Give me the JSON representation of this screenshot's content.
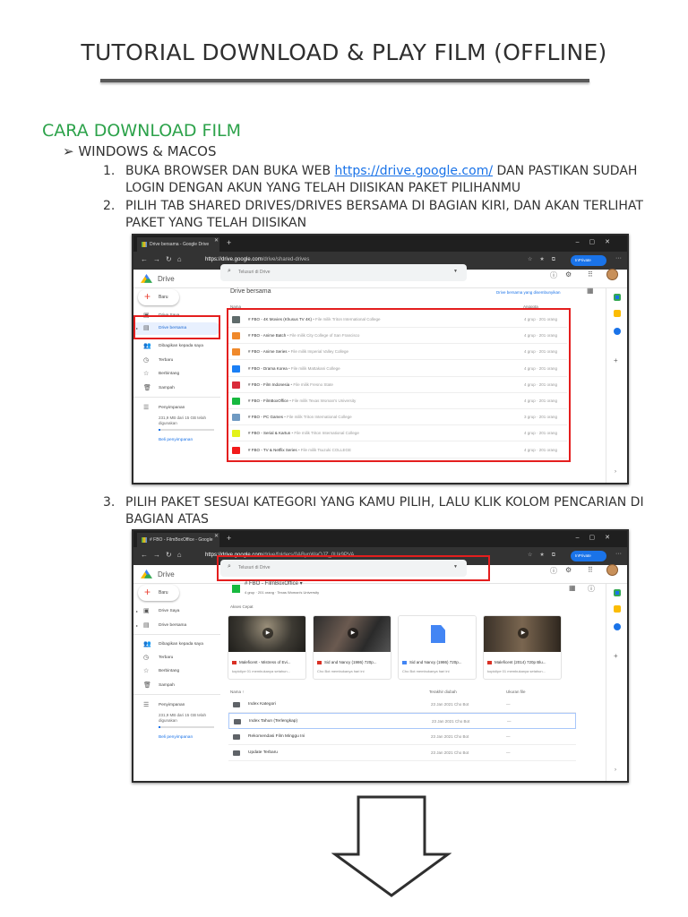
{
  "title": "TUTORIAL DOWNLOAD & PLAY FILM (OFFLINE)",
  "section": "CARA DOWNLOAD FILM",
  "subsection": "WINDOWS & MACOS",
  "steps": [
    {
      "num": "1.",
      "before": "BUKA BROWSER DAN BUKA WEB ",
      "link": "https://drive.google.com/",
      "after": " DAN PASTIKAN SUDAH LOGIN DENGAN AKUN YANG TELAH DIISIKAN PAKET PILIHANMU"
    },
    {
      "num": "2.",
      "text": "PILIH TAB SHARED DRIVES/DRIVES BERSAMA DI BAGIAN KIRI, DAN AKAN TERLIHAT PAKET YANG TELAH DIISIKAN"
    },
    {
      "num": "3.",
      "text": "PILIH PAKET SESUAI KATEGORI YANG KAMU PILIH, LALU KLIK KOLOM PENCARIAN DI BAGIAN ATAS"
    }
  ],
  "browser": {
    "inprivate": "InPrivate",
    "app": "Drive",
    "search_placeholder": "Telusuri di Drive",
    "new": "Baru"
  },
  "shot1": {
    "tab": "Drive bersama - Google Drive",
    "url_host": "https://drive.google.com",
    "url_path": "/drive/shared-drives",
    "heading": "Drive bersama",
    "hidden_link": "Drive bersama yang disembunyikan",
    "col_name": "Nama",
    "col_members": "Anggota",
    "sidebar": [
      "Drive Saya",
      "Drive bersama",
      "Dibagikan kepada saya",
      "Terbaru",
      "Berbintang",
      "Sampah",
      "Penyimpanan"
    ],
    "storage": "231,9 MB dari 15 GB telah digunakan",
    "storage_fraction": 0.015,
    "buy": "Beli penyimpanan",
    "drives": [
      {
        "name": "# FBO - 4K Movies (Khusus TV 4K)",
        "owner": " • File milik Triton International College",
        "members": "4 grup · 201 orang",
        "color": "#5f6b6b"
      },
      {
        "name": "# FBO - Anime Batch",
        "owner": " • File milik City College of San Francisco",
        "members": "4 grup · 201 orang",
        "color": "#f0892b"
      },
      {
        "name": "# FBO - Anime Series",
        "owner": " • File milik Imperial Valley College",
        "members": "4 grup · 201 orang",
        "color": "#f0892b"
      },
      {
        "name": "# FBO - Drama Korea",
        "owner": " • File milik Mattakani College",
        "members": "4 grup · 201 orang",
        "color": "#1a7ff5"
      },
      {
        "name": "# FBO - Film Indonesia",
        "owner": " • File milik Fresno State",
        "members": "4 grup · 201 orang",
        "color": "#d92b3a"
      },
      {
        "name": "# FBO - FilmBoxOffice",
        "owner": " • File milik Texas Woman's University",
        "members": "4 grup · 201 orang",
        "color": "#17b93f"
      },
      {
        "name": "# FBO - PC Games",
        "owner": " • File milik Triton International College",
        "members": "3 grup · 201 orang",
        "color": "#6f9ac2"
      },
      {
        "name": "# FBO - Serial & Kartun",
        "owner": " • File milik Triton International College",
        "members": "4 grup · 201 orang",
        "color": "#e3f21a"
      },
      {
        "name": "# FBO - TV & Netflix Series",
        "owner": " • File milik Tsuzuki COLLEGE",
        "members": "4 grup · 201 orang",
        "color": "#f21a1a"
      }
    ]
  },
  "shot2": {
    "tab": "# FBO - FilmBoxOffice - Google",
    "url_host": "https://drive.google.com",
    "url_path": "/drive/folders/0ABynWaOJZ_0Uk9PVA",
    "folder": "# FBO - FilmBoxOffice ▾",
    "folder_meta": "4 grup · 201 orang · Texas Woman's University",
    "quick": "Akses Cepat",
    "cards": [
      {
        "name": "Maleficent - Mistress of Evi...",
        "sub": "kopiclipe 01 membukanya setahun...",
        "type": "video"
      },
      {
        "name": "Sid and Nancy (1986) 720p...",
        "sub": "Cho Bot membukanya hari ini",
        "type": "video"
      },
      {
        "name": "Sid and Nancy (1986) 720p...",
        "sub": "Cho Bot membukanya hari ini",
        "type": "doc"
      },
      {
        "name": "Maleficent (2014) 720p Blu...",
        "sub": "kopiclipe 01 membukanya setahun...",
        "type": "video"
      }
    ],
    "col_name": "Nama ↑",
    "col_modified": "Terakhir diubah",
    "col_size": "Ukuran file",
    "folders": [
      {
        "name": "Index Kategori",
        "modified": "23 Jan 2021 Cho Bot",
        "size": "—"
      },
      {
        "name": "Index Tahun (Terlengkap)",
        "modified": "23 Jan 2021 Cho Bot",
        "size": "—"
      },
      {
        "name": "Rekomendasi Film Minggu Ini",
        "modified": "23 Jan 2021 Cho Bot",
        "size": "—"
      },
      {
        "name": "Update Terbaru",
        "modified": "23 Jan 2021 Cho Bot",
        "size": "—"
      }
    ]
  },
  "colors": {
    "accent_green": "#2ca24a",
    "highlight_red": "#e41e1e",
    "link_blue": "#1a73e8"
  }
}
